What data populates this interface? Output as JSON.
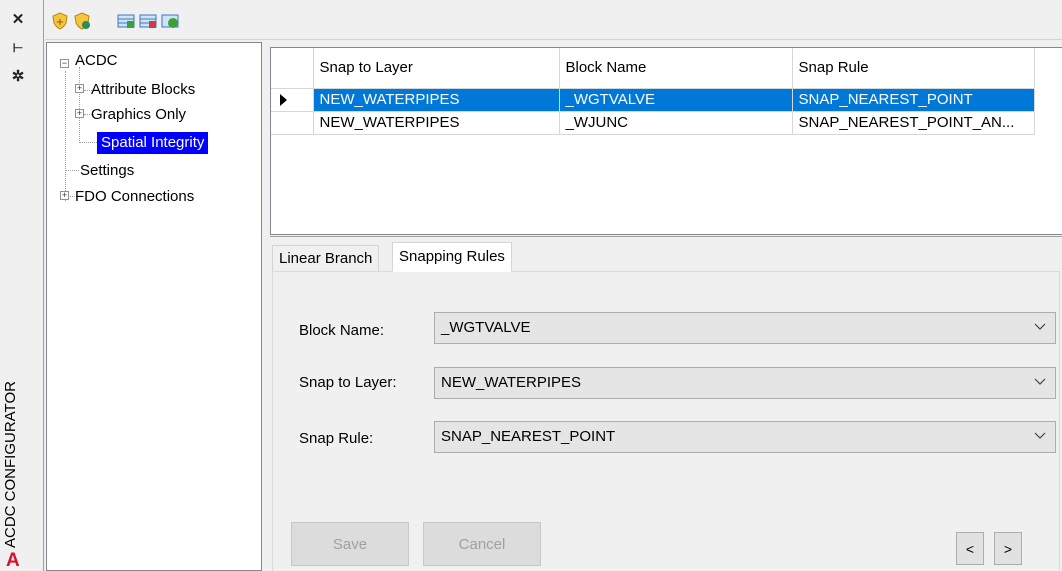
{
  "palette": {
    "title": "ACDC CONFIGURATOR",
    "icons": [
      "close-icon",
      "pin-icon",
      "settings-icon"
    ],
    "logo": "A"
  },
  "toolbar": {
    "icons": [
      "shield-add-icon",
      "shield-remove-icon",
      "grid-add-icon",
      "grid-remove-icon",
      "grid-refresh-icon"
    ]
  },
  "tree": {
    "root": "ACDC",
    "items": [
      {
        "label": "Attribute Blocks",
        "expandable": true
      },
      {
        "label": "Graphics Only",
        "expandable": true
      },
      {
        "label": "Spatial Integrity",
        "expandable": false,
        "selected": true
      }
    ],
    "settings": "Settings",
    "fdo": "FDO Connections"
  },
  "grid": {
    "columns": [
      "Snap to Layer",
      "Block Name",
      "Snap Rule"
    ],
    "rows": [
      {
        "layer": "NEW_WATERPIPES",
        "block": "_WGTVALVE",
        "rule": "SNAP_NEAREST_POINT",
        "selected": true
      },
      {
        "layer": "NEW_WATERPIPES",
        "block": "_WJUNC",
        "rule": "SNAP_NEAREST_POINT_AN...",
        "selected": false
      }
    ]
  },
  "tabs": [
    {
      "label": "Linear Branch",
      "active": false
    },
    {
      "label": "Snapping Rules",
      "active": true
    }
  ],
  "form": {
    "block_name_label": "Block Name:",
    "block_name_value": "_WGTVALVE",
    "snap_layer_label": "Snap to Layer:",
    "snap_layer_value": "NEW_WATERPIPES",
    "snap_rule_label": "Snap Rule:",
    "snap_rule_value": "SNAP_NEAREST_POINT"
  },
  "buttons": {
    "save": "Save",
    "cancel": "Cancel",
    "prev": "<",
    "next": ">"
  },
  "colors": {
    "selection_blue": "#0078d7",
    "tree_selection": "#0000ff",
    "logo_red": "#d9102c"
  }
}
